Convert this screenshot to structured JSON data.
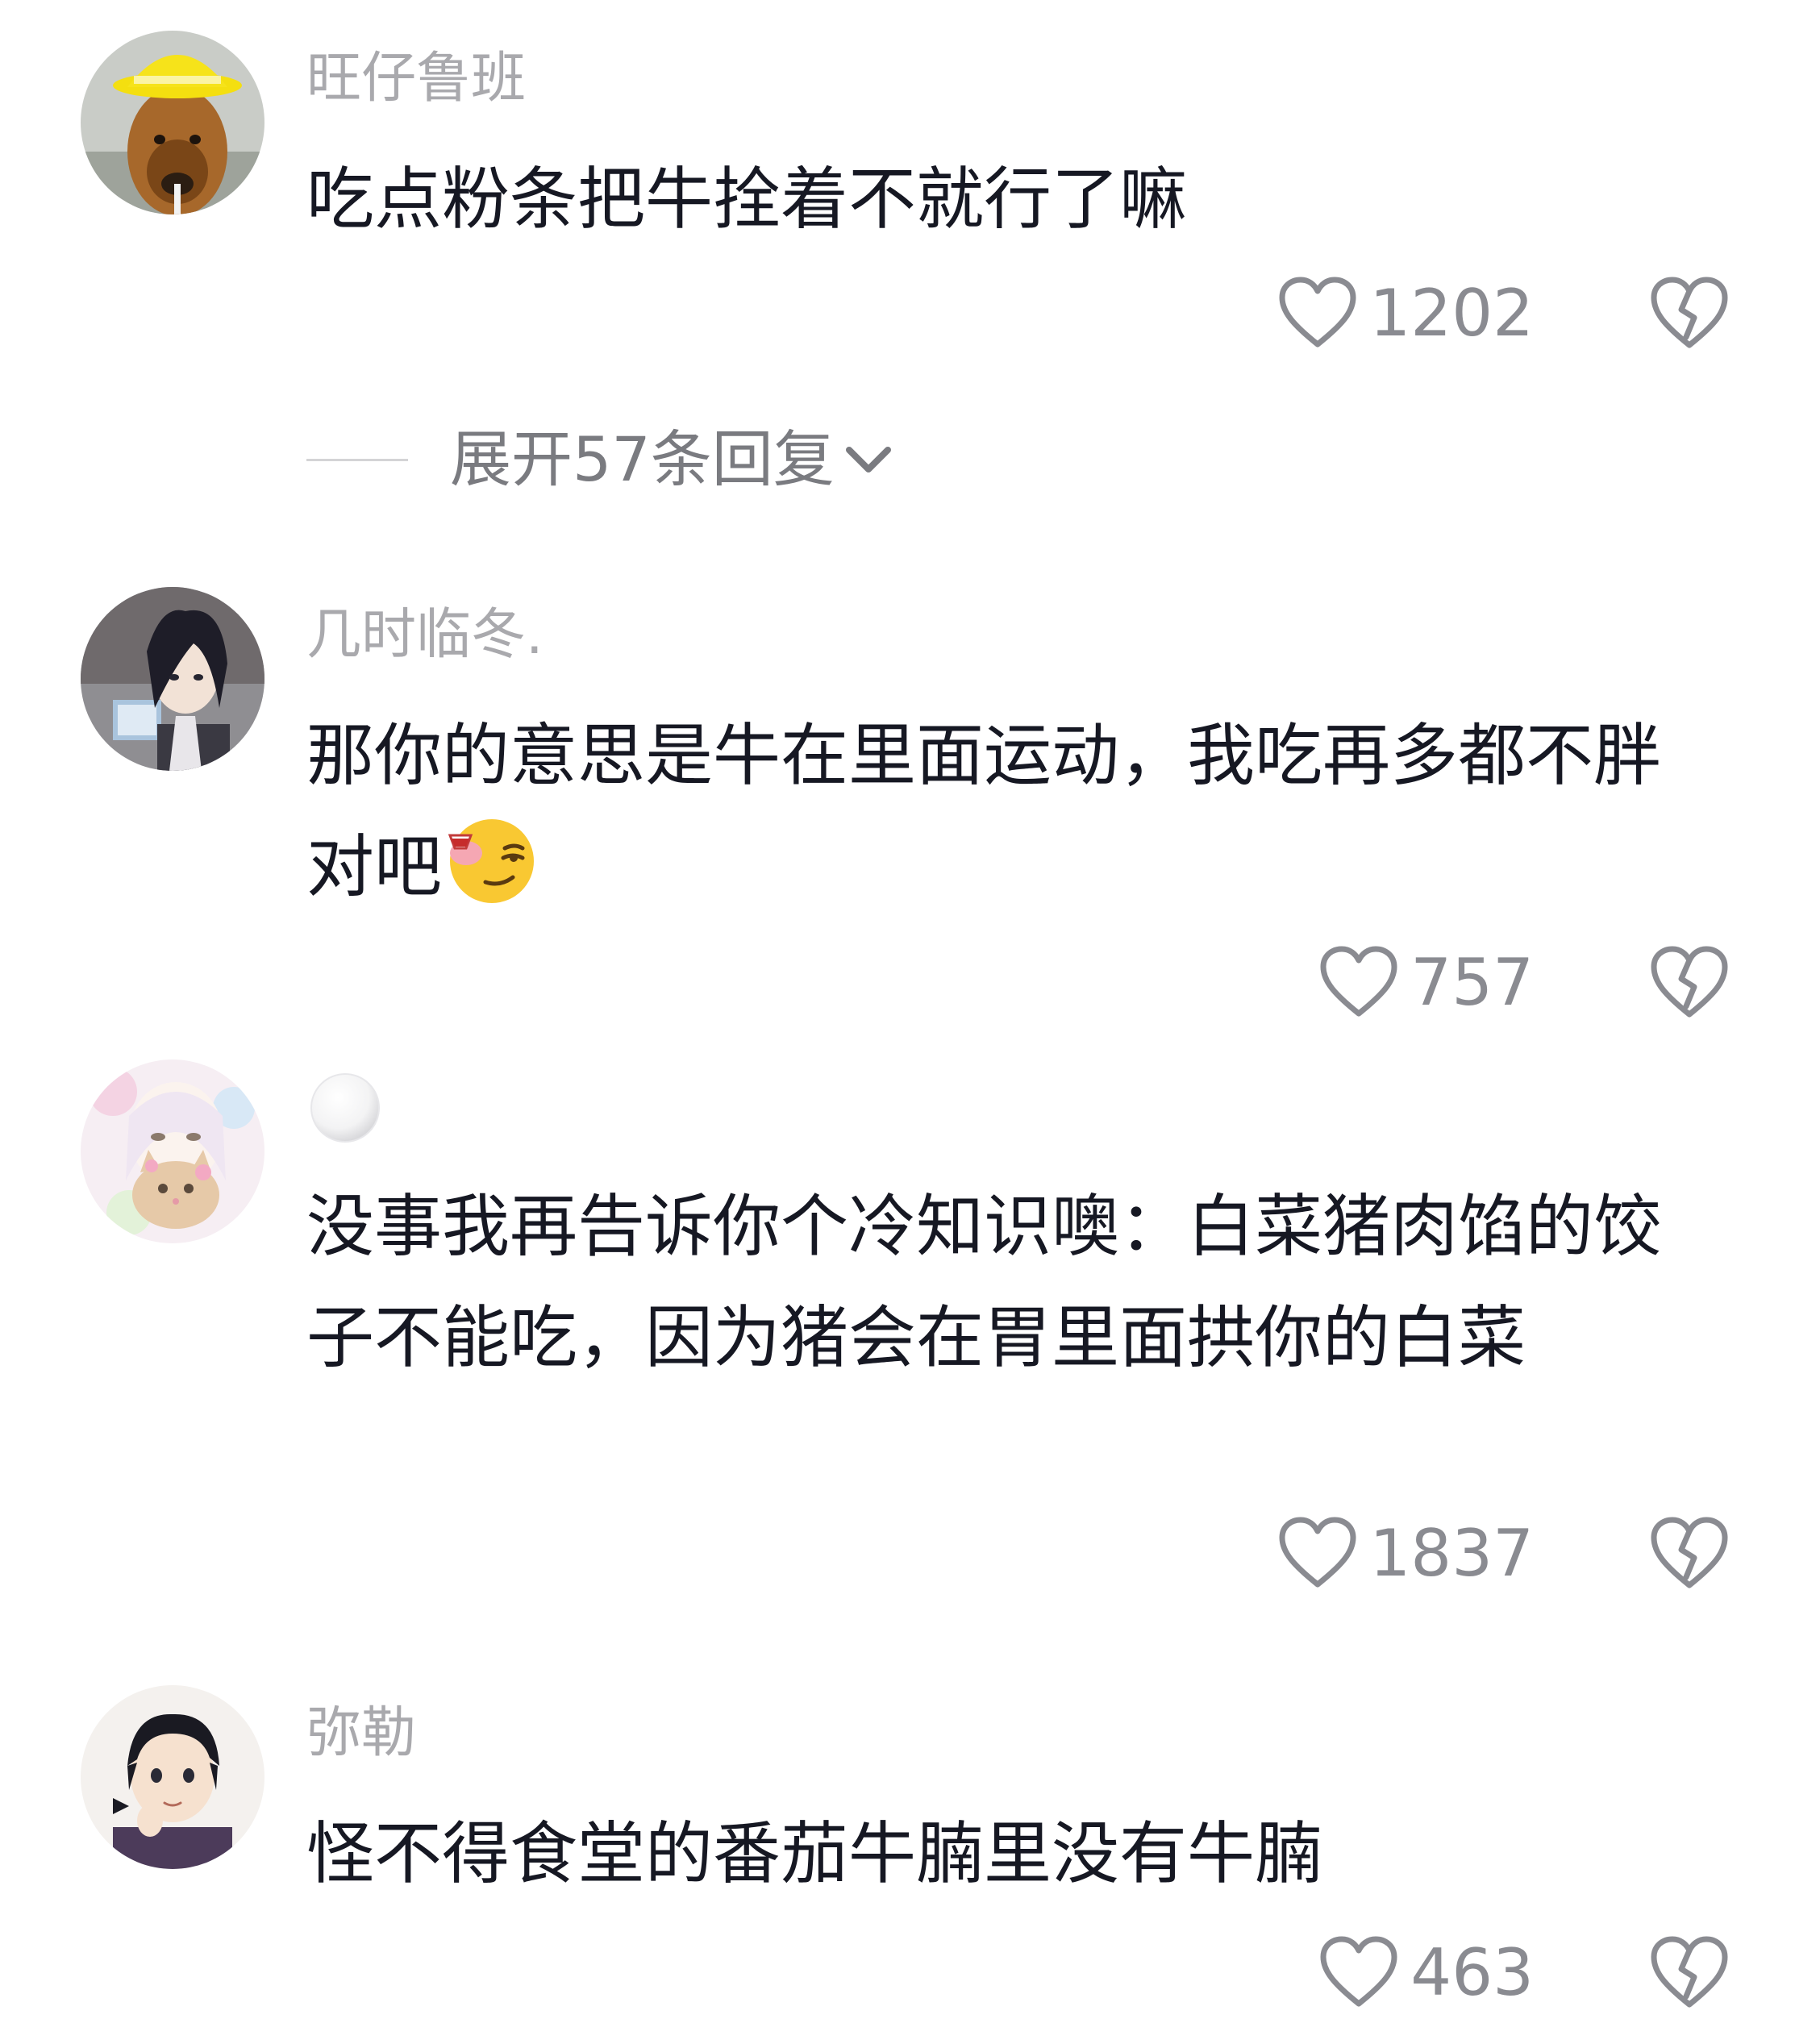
{
  "comments": [
    {
      "username": "旺仔鲁班",
      "text": "吃点粉条把牛拴着不就行了嘛",
      "likes": "1202",
      "avatar_icon": "dog-with-hardhat-avatar"
    },
    {
      "username": "几时临冬.",
      "text": "那你的意思是牛在里面运动，我吃再多都不胖对吧",
      "emoji_icon": "smirk-wine-emoji",
      "likes": "757",
      "avatar_icon": "anime-boy-avatar"
    },
    {
      "username": "",
      "username_icon": "white-ball-icon",
      "text": "没事我再告诉你个冷知识噢：白菜猪肉馅的饺子不能吃，因为猪会在胃里面拱你的白菜",
      "likes": "1837",
      "avatar_icon": "pastel-girl-cat-avatar"
    },
    {
      "username": "弥勒",
      "text": "怪不得食堂的番茄牛腩里没有牛腩",
      "likes": "463",
      "avatar_icon": "anime-boy-pose-avatar"
    }
  ],
  "expand_replies": {
    "label": "展开57条回复",
    "icon": "chevron-down-icon"
  },
  "colors": {
    "username": "#a9a9ad",
    "text": "#161823",
    "count": "#8a8b91",
    "icon_stroke": "#8a8b91"
  }
}
